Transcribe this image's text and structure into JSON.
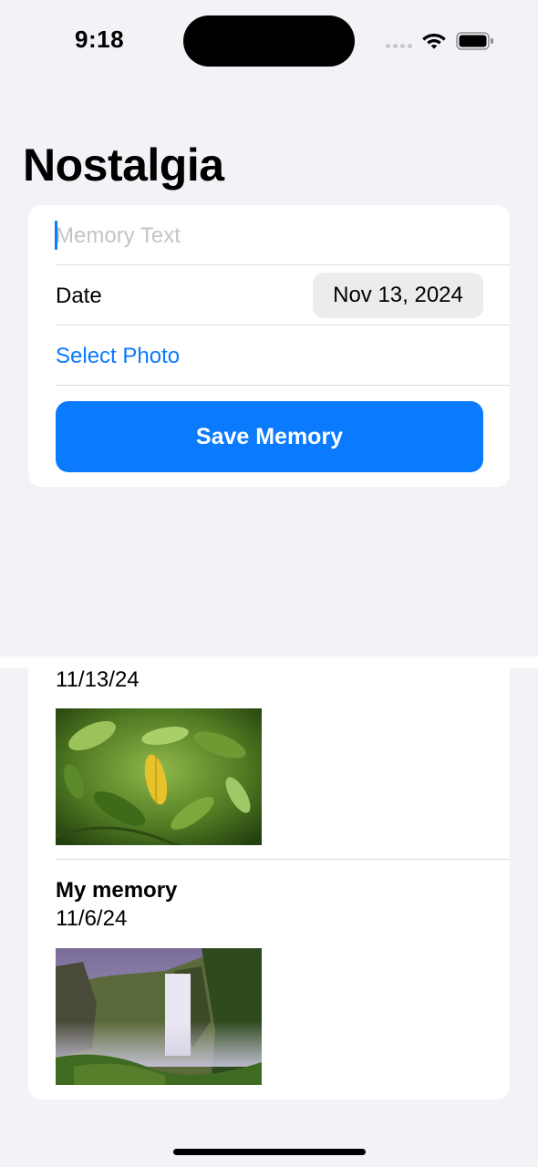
{
  "status_bar": {
    "time": "9:18"
  },
  "app": {
    "title": "Nostalgia"
  },
  "form": {
    "memory_text_placeholder": "Memory Text",
    "memory_text_value": "",
    "date_label": "Date",
    "date_value": "Nov 13, 2024",
    "select_photo_label": "Select Photo",
    "save_button_label": "Save Memory"
  },
  "memories": [
    {
      "title": "",
      "date": "11/13/24",
      "photo": "leaves-photo"
    },
    {
      "title": "My memory",
      "date": "11/6/24",
      "photo": "waterfall-photo"
    }
  ],
  "colors": {
    "accent": "#0A7AFF",
    "background": "#F2F2F7"
  }
}
